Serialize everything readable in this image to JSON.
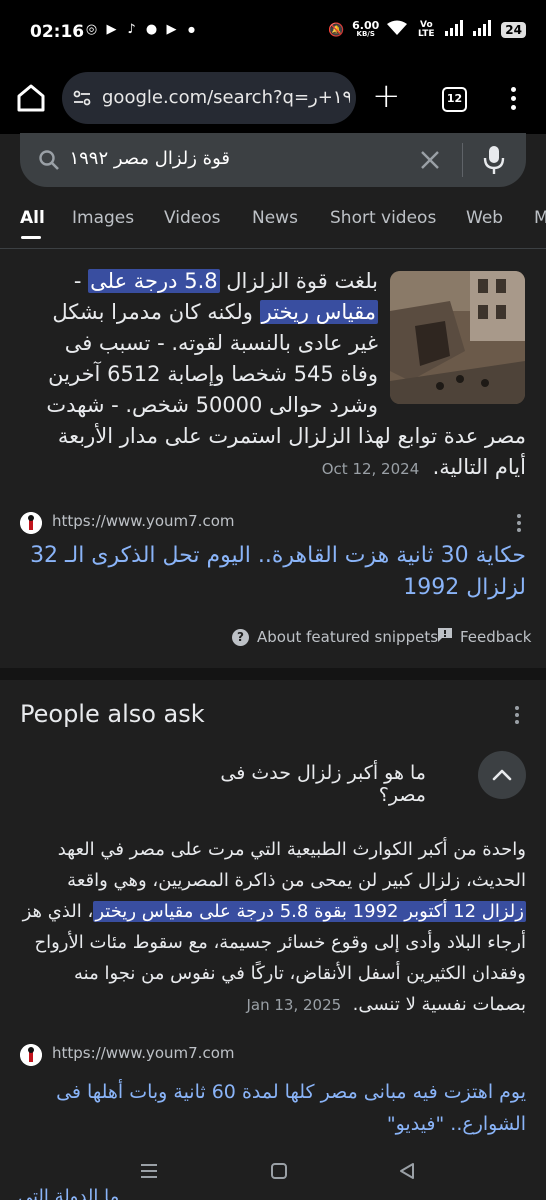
{
  "status_bar": {
    "time": "02:16",
    "net_speed_value": "6.00",
    "net_speed_unit": "KB/S",
    "volte": "Vo LTE",
    "battery": "24"
  },
  "browser": {
    "url": "google.com/search?q=١٩٩٢+ر",
    "tab_count": "12"
  },
  "search": {
    "query": "قوة زلزال مصر ١٩٩٢"
  },
  "tabs": [
    "All",
    "Images",
    "Videos",
    "News",
    "Short videos",
    "Web",
    "M"
  ],
  "featured_snippet": {
    "line1_pre": "بلغت قوة الزلزال ",
    "line1_hl": "5.8 درجة على",
    "line1_post": " -",
    "line2_hl": "مقياس ريختر",
    "line2_post": " ولكنه كان مدمرا بشكل",
    "line3": "غير عادى بالنسبة لقوته. - تسبب فى",
    "line4": "وفاة 545 شخصا وإصابة 6512 آخرين",
    "line5": "وشرد حوالى 50000 شخص. - شهدت",
    "line6": "مصر عدة توابع لهذا الزلزال استمرت على مدار الأربعة",
    "line7": "أيام التالية.",
    "date": "Oct 12, 2024",
    "source_url": "https://www.youm7.com",
    "link_title": "حكاية 30 ثانية هزت القاهرة.. اليوم تحل الذكرى الـ 32 لزلزال 1992",
    "about_label": "About featured snippets",
    "feedback_label": "Feedback"
  },
  "people_also_ask": {
    "title": "People also ask",
    "question": "ما هو أكبر زلزال حدث فى مصر؟",
    "answer_pre": "واحدة من أكبر الكوارث الطبيعية التي مرت على مصر في العهد الحديث، زلزال كبير لن يمحى من ذاكرة المصريين، وهي واقعة ",
    "answer_hl": "زلزال 12 أكتوبر 1992 بقوة 5.8 درجة على مقياس ريختر",
    "answer_post": "، الذي هز أرجاء البلاد وأدى إلى وقوع خسائر جسيمة، مع سقوط مئات الأرواح وفقدان الكثيرين أسفل الأنقاض، تاركًا في نفوس من نجوا منه بصمات نفسية لا تنسى.",
    "date": "Jan 13, 2025",
    "source_url": "https://www.youm7.com",
    "link_title": "يوم اهتزت فيه مبانى مصر كلها لمدة 60 ثانية وبات أهلها فى الشوارع.. \"فيديو\"",
    "next_link_clipped": "ما الدولة التي"
  }
}
